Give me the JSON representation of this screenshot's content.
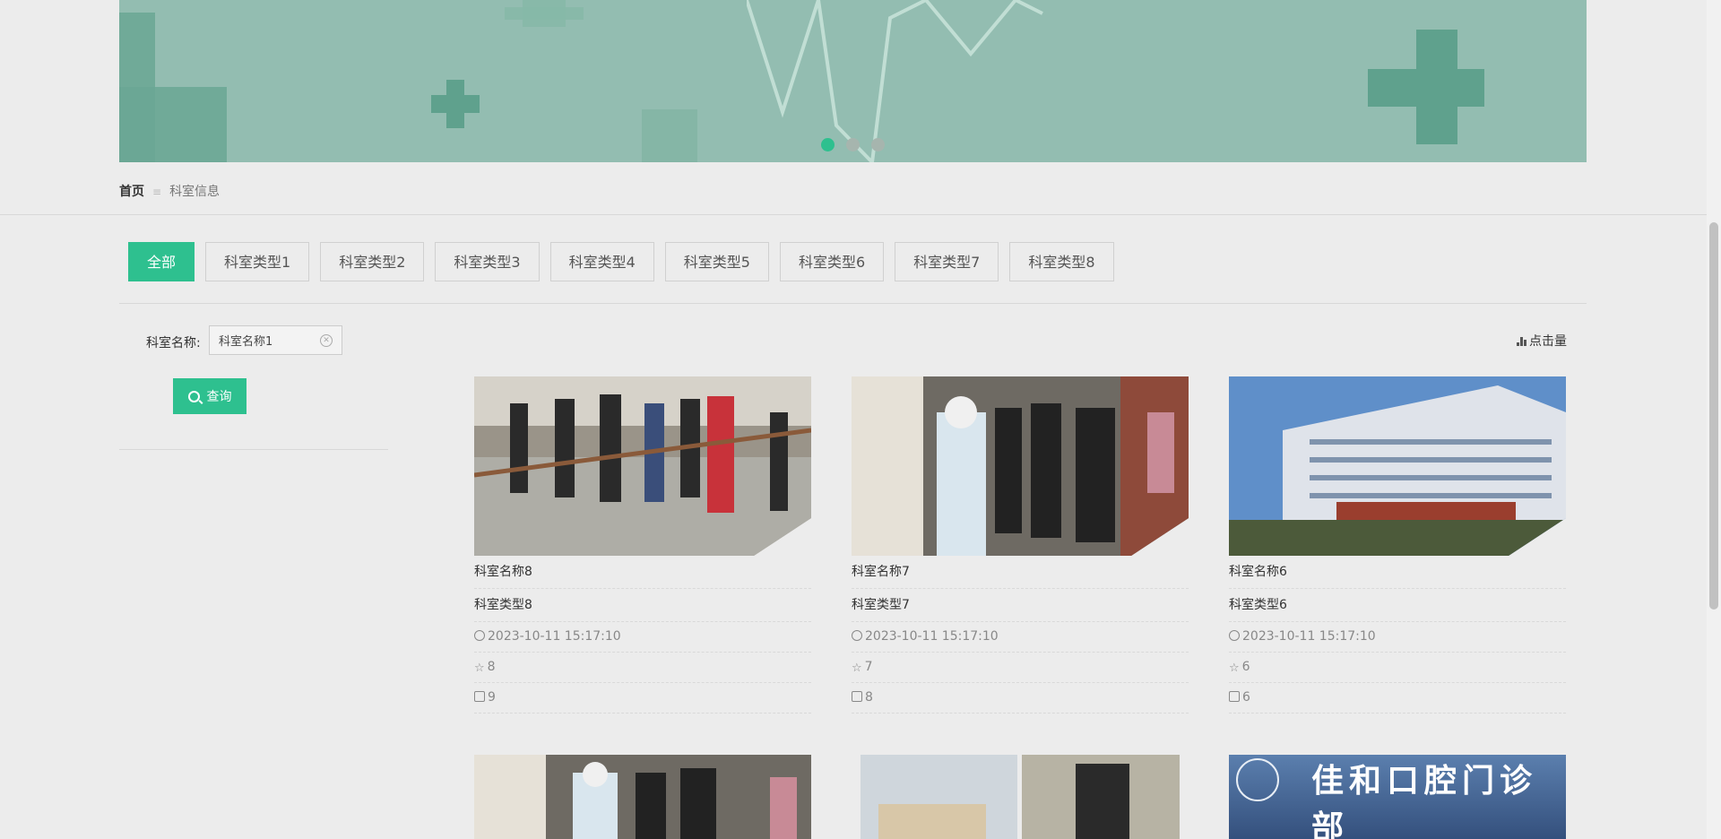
{
  "breadcrumb": {
    "home": "首页",
    "separator": "≡",
    "current": "科室信息"
  },
  "tabs": [
    "全部",
    "科室类型1",
    "科室类型2",
    "科室类型3",
    "科室类型4",
    "科室类型5",
    "科室类型6",
    "科室类型7",
    "科室类型8"
  ],
  "search": {
    "label": "科室名称:",
    "value": "科室名称1",
    "button": "查询",
    "clear_icon": "circle-x-icon"
  },
  "sort_label": "点击量",
  "carousel": {
    "slides": 3,
    "active": 0
  },
  "cards": [
    {
      "name": "科室名称8",
      "type": "科室类型8",
      "time": "2023-10-11 15:17:10",
      "likes": "8",
      "comments": "9"
    },
    {
      "name": "科室名称7",
      "type": "科室类型7",
      "time": "2023-10-11 15:17:10",
      "likes": "7",
      "comments": "8"
    },
    {
      "name": "科室名称6",
      "type": "科室类型6",
      "time": "2023-10-11 15:17:10",
      "likes": "6",
      "comments": "6"
    },
    {
      "name": "",
      "type": "",
      "time": "",
      "likes": "",
      "comments": ""
    },
    {
      "name": "",
      "type": "",
      "time": "",
      "likes": "",
      "comments": ""
    },
    {
      "name": "",
      "type": "",
      "time": "",
      "likes": "",
      "comments": ""
    }
  ],
  "banner_sign": "佳和口腔门诊部",
  "colors": {
    "accent": "#2ec08f",
    "banner": "#93bdb1"
  }
}
